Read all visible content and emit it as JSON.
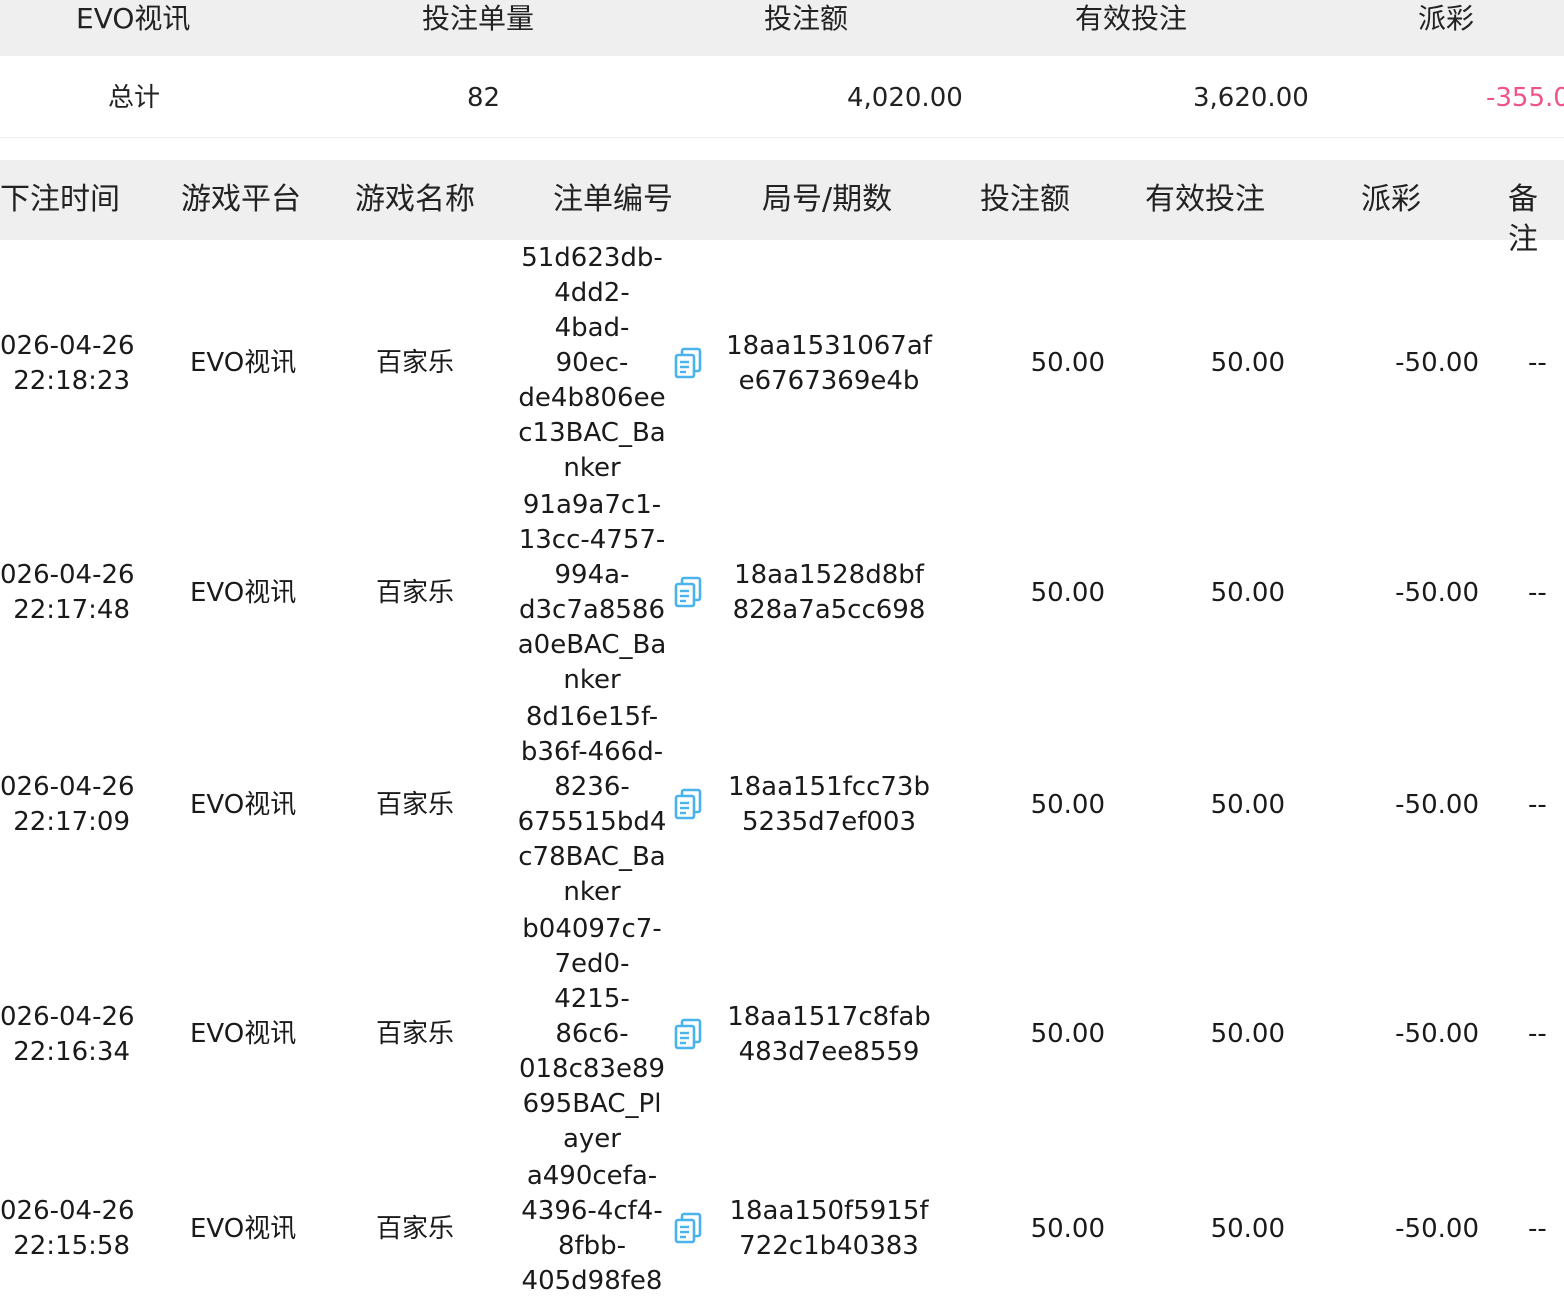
{
  "summary": {
    "headers": [
      "EVO视讯",
      "投注单量",
      "投注额",
      "有效投注",
      "派彩"
    ],
    "label": "总计",
    "order_count": "82",
    "bet_amount": "4,020.00",
    "valid_bet": "3,620.00",
    "payout": "-355.0"
  },
  "table": {
    "headers": [
      "下注时间",
      "游戏平台",
      "游戏名称",
      "注单编号",
      "局号/期数",
      "投注额",
      "有效投注",
      "派彩",
      "备注"
    ],
    "rows": [
      {
        "time": [
          "026-04-26",
          "22:18:23"
        ],
        "platform": "EVO视讯",
        "game": "百家乐",
        "bet_id": [
          "51d623db-",
          "4dd2-",
          "4bad-",
          "90ec-",
          "de4b806ee",
          "c13BAC_Ba",
          "nker"
        ],
        "round": [
          "18aa1531067af",
          "e6767369e4b"
        ],
        "bet": "50.00",
        "valid": "50.00",
        "payout": "-50.00",
        "note": "--"
      },
      {
        "time": [
          "026-04-26",
          "22:17:48"
        ],
        "platform": "EVO视讯",
        "game": "百家乐",
        "bet_id": [
          "91a9a7c1-",
          "13cc-4757-",
          "994a-",
          "d3c7a8586",
          "a0eBAC_Ba",
          "nker"
        ],
        "round": [
          "18aa1528d8bf",
          "828a7a5cc698"
        ],
        "bet": "50.00",
        "valid": "50.00",
        "payout": "-50.00",
        "note": "--"
      },
      {
        "time": [
          "026-04-26",
          "22:17:09"
        ],
        "platform": "EVO视讯",
        "game": "百家乐",
        "bet_id": [
          "8d16e15f-",
          "b36f-466d-",
          "8236-",
          "675515bd4",
          "c78BAC_Ba",
          "nker"
        ],
        "round": [
          "18aa151fcc73b",
          "5235d7ef003"
        ],
        "bet": "50.00",
        "valid": "50.00",
        "payout": "-50.00",
        "note": "--"
      },
      {
        "time": [
          "026-04-26",
          "22:16:34"
        ],
        "platform": "EVO视讯",
        "game": "百家乐",
        "bet_id": [
          "b04097c7-",
          "7ed0-",
          "4215-",
          "86c6-",
          "018c83e89",
          "695BAC_Pl",
          "ayer"
        ],
        "round": [
          "18aa1517c8fab",
          "483d7ee8559"
        ],
        "bet": "50.00",
        "valid": "50.00",
        "payout": "-50.00",
        "note": "--"
      },
      {
        "time": [
          "026-04-26",
          "22:15:58"
        ],
        "platform": "EVO视讯",
        "game": "百家乐",
        "bet_id": [
          "a490cefa-",
          "4396-4cf4-",
          "8fbb-",
          "405d98fe8"
        ],
        "round": [
          "18aa150f5915f",
          "722c1b40383"
        ],
        "bet": "50.00",
        "valid": "50.00",
        "payout": "-50.00",
        "note": "--"
      }
    ]
  },
  "colors": {
    "header_bg": "#efefef",
    "negative": "#f0528a",
    "copy_icon": "#4ab3ee"
  },
  "icons": {
    "copy": "copy-icon"
  }
}
